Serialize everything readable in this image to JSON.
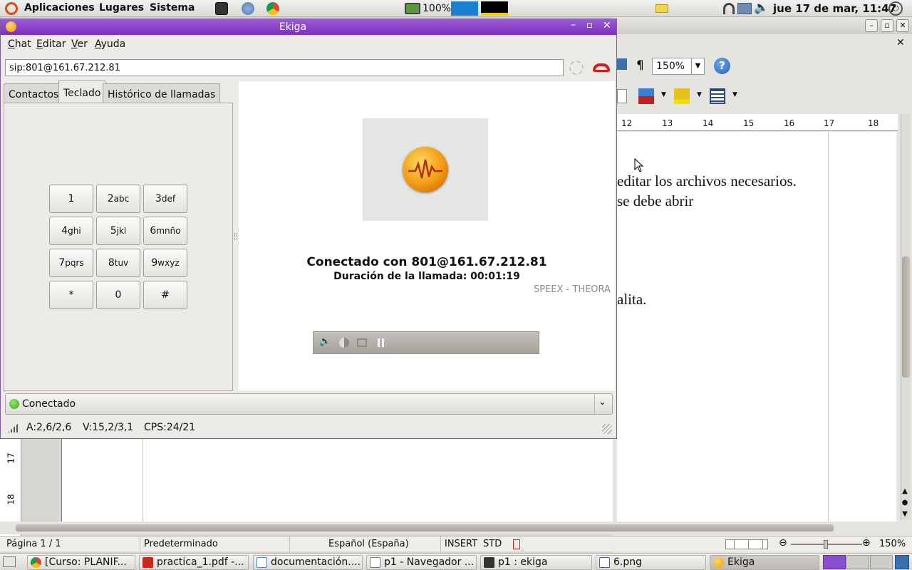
{
  "top_panel": {
    "menus": [
      "Aplicaciones",
      "Lugares",
      "Sistema"
    ],
    "battery": "100%",
    "datetime": "jue 17 de mar, 11:47"
  },
  "writer": {
    "zoom": "150%",
    "help_icon": "help-icon",
    "ruler_numbers": [
      "12",
      "13",
      "14",
      "15",
      "16",
      "17",
      "18"
    ],
    "body_lines": [
      "editar los archivos necesarios.",
      "se debe abrir",
      "alita."
    ],
    "vruler_numbers": [
      "17",
      "18"
    ],
    "statusbar": {
      "page": "Página  1 / 1",
      "style": "Predeterminado",
      "language": "Español (España)",
      "mode": "INSERT",
      "selection": "STD",
      "zoom": "150%"
    }
  },
  "ekiga": {
    "title": "Ekiga",
    "menu": [
      {
        "label": "Chat",
        "key": "C",
        "rest": "hat"
      },
      {
        "label": "Editar",
        "key": "E",
        "rest": "ditar"
      },
      {
        "label": "Ver",
        "key": "V",
        "rest": "er"
      },
      {
        "label": "Ayuda",
        "key": "A",
        "rest": "yuda"
      }
    ],
    "uri": "sip:801@161.67.212.81",
    "tabs": [
      "Contactos",
      "Teclado",
      "Histórico de llamadas"
    ],
    "active_tab": "Teclado",
    "keypad": [
      {
        "digit": "1",
        "letters": ""
      },
      {
        "digit": "2",
        "letters": "abc"
      },
      {
        "digit": "3",
        "letters": "def"
      },
      {
        "digit": "4",
        "letters": "ghi"
      },
      {
        "digit": "5",
        "letters": "jkl"
      },
      {
        "digit": "6",
        "letters": "mnño"
      },
      {
        "digit": "7",
        "letters": "pqrs"
      },
      {
        "digit": "8",
        "letters": "tuv"
      },
      {
        "digit": "9",
        "letters": "wxyz"
      },
      {
        "digit": "*",
        "letters": ""
      },
      {
        "digit": "0",
        "letters": ""
      },
      {
        "digit": "#",
        "letters": ""
      }
    ],
    "call_status": "Conectado con 801@161.67.212.81",
    "call_duration": "Duración de la llamada: 00:01:19",
    "codecs": "SPEEX - THEORA",
    "presence": "Conectado",
    "presence_color": "#4cc12a",
    "stats": {
      "audio": "A:2,6/2,6",
      "video": "V:15,2/3,1",
      "cps": "CPS:24/21"
    },
    "accent": "#8440c8",
    "hangup_color": "#d02020"
  },
  "taskbar": [
    {
      "label": "[Curso: PLANIF...",
      "icon": "chrome-icon",
      "color": "#e8b020"
    },
    {
      "label": "practica_1.pdf -...",
      "icon": "pdf-icon",
      "color": "#c8281e"
    },
    {
      "label": "documentación....",
      "icon": "writer-doc-icon",
      "color": "#5a7fb8"
    },
    {
      "label": "p1 - Navegador ...",
      "icon": "file-browser-icon",
      "color": "#7a7a7a"
    },
    {
      "label": "p1 : ekiga",
      "icon": "terminal-icon",
      "color": "#333333"
    },
    {
      "label": "6.png",
      "icon": "image-icon",
      "color": "#555577"
    },
    {
      "label": "Ekiga",
      "icon": "ekiga-icon",
      "color": "#f29a12"
    }
  ]
}
